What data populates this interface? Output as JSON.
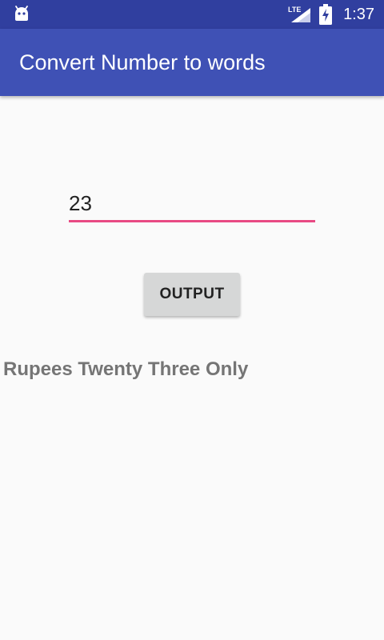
{
  "status_bar": {
    "icons": [
      "android-icon",
      "lte-signal-icon",
      "battery-charging-icon"
    ],
    "network_label": "LTE",
    "time": "1:37"
  },
  "app_bar": {
    "title": "Convert Number to words"
  },
  "form": {
    "number_value": "23",
    "button_label": "OUTPUT",
    "result": "Rupees Twenty Three Only"
  },
  "colors": {
    "status_bar": "#303f9f",
    "app_bar": "#3f51b5",
    "accent": "#e84a83",
    "background": "#fafafa",
    "button": "#d6d7d7",
    "result_text": "#757575"
  }
}
